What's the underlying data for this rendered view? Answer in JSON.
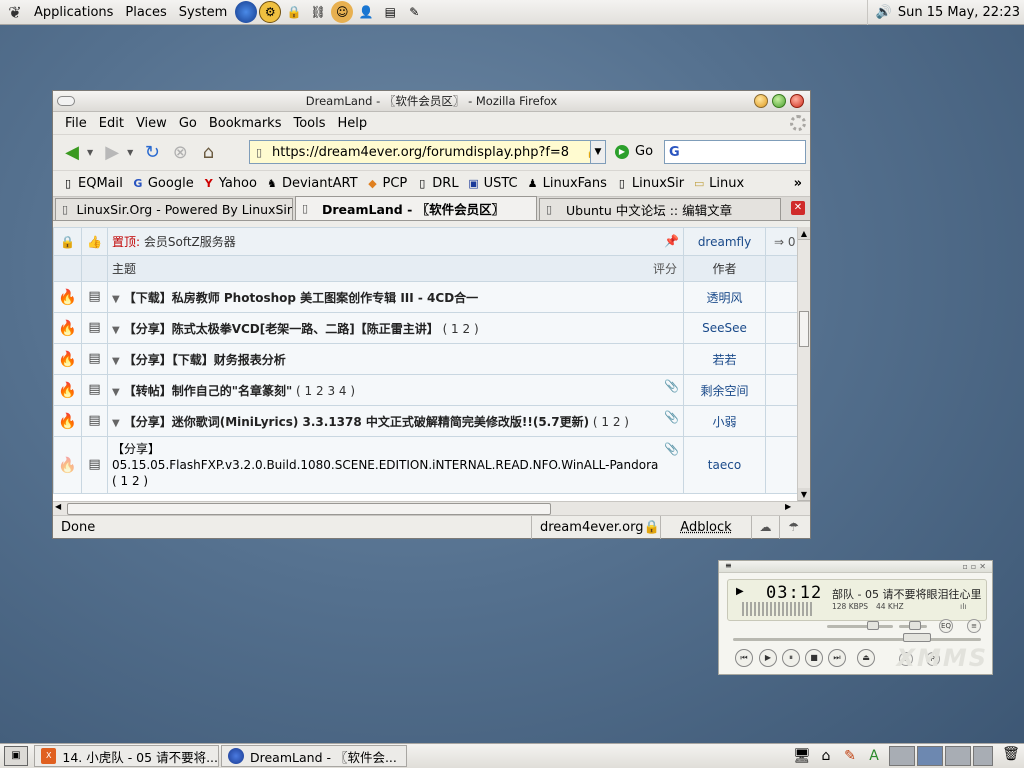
{
  "top_panel": {
    "menus": [
      "Applications",
      "Places",
      "System"
    ],
    "launchers": [
      "firefox-globe-icon",
      "gear-app-icon",
      "lock-app-icon",
      "chain-link-icon",
      "face-icon",
      "user-icon",
      "scanner-icon",
      "pen-icon"
    ],
    "clock": "Sun 15 May, 22:23"
  },
  "window": {
    "title": "DreamLand - 〖软件会员区〗 - Mozilla Firefox",
    "menu": [
      "File",
      "Edit",
      "View",
      "Go",
      "Bookmarks",
      "Tools",
      "Help"
    ],
    "nav": {
      "url": "https://dream4ever.org/forumdisplay.php?f=8",
      "go_label": "Go",
      "search_value": ""
    },
    "bookmarks": [
      {
        "label": "EQMail",
        "icon": "page-icon"
      },
      {
        "label": "Google",
        "icon": "google-icon"
      },
      {
        "label": "Yahoo",
        "icon": "yahoo-icon"
      },
      {
        "label": "DeviantART",
        "icon": "deviantart-icon"
      },
      {
        "label": "PCP",
        "icon": "pcp-icon"
      },
      {
        "label": "DRL",
        "icon": "page-icon"
      },
      {
        "label": "USTC",
        "icon": "ustc-icon"
      },
      {
        "label": "LinuxFans",
        "icon": "tux-icon"
      },
      {
        "label": "LinuxSir",
        "icon": "page-icon"
      },
      {
        "label": "Linux",
        "icon": "folder-icon"
      }
    ],
    "bookmarks_more": "»",
    "tabs": [
      {
        "label": "LinuxSir.Org - Powered By LinuxSir",
        "active": false
      },
      {
        "label": "DreamLand - 〖软件会员区〗",
        "active": true
      },
      {
        "label": "Ubuntu 中文论坛 :: 编辑文章",
        "active": false
      }
    ],
    "forum": {
      "pinned": {
        "label": "置顶:",
        "text": "会员SoftZ服务器",
        "author": "dreamfly",
        "extra": "0"
      },
      "header": {
        "subject": "主题",
        "rating": "评分",
        "author": "作者"
      },
      "threads": [
        {
          "title": "【下载】私房教师 Photoshop 美工图案创作专辑 III - 4CD合一",
          "pages": "",
          "attach": false,
          "author": "透明风"
        },
        {
          "title": "【分享】陈式太极拳VCD[老架一路、二路]【陈正雷主讲】",
          "pages": "( 1 2 )",
          "attach": false,
          "author": "SeeSee"
        },
        {
          "title": "【分享】【下载】财务报表分析",
          "pages": "",
          "attach": false,
          "author": "若若"
        },
        {
          "title": "【转帖】制作自己的\"名章篆刻\"",
          "pages": "( 1 2 3 4 )",
          "attach": true,
          "author": "剩余空间"
        },
        {
          "title": "【分享】迷你歌词(MiniLyrics) 3.3.1378 中文正式破解精简完美修改版!!(5.7更新)",
          "pages": "( 1 2 )",
          "attach": true,
          "author": "小弱"
        },
        {
          "title": "【分享】",
          "line2": "05.15.05.FlashFXP.v3.2.0.Build.1080.SCENE.EDITION.iNTERNAL.READ.NFO.WinALL-Pandora",
          "pages": "( 1 2 )",
          "attach": true,
          "author": "taeco"
        }
      ]
    },
    "status": {
      "text": "Done",
      "host": "dream4ever.org",
      "adblock": "Adblock"
    }
  },
  "xmms": {
    "time": "03:12",
    "song": "部队 - 05 请不要将眼泪往心里",
    "kbps": "128 KBPS",
    "khz": "44 KHZ",
    "watermark": "XMMS",
    "volume_level": 0.6
  },
  "taskbar": {
    "tasks": [
      {
        "label": "14. 小虎队 - 05 请不要将..."
      },
      {
        "label": "DreamLand - 〖软件会..."
      }
    ],
    "workspaces": 4,
    "active_workspace": 2
  }
}
